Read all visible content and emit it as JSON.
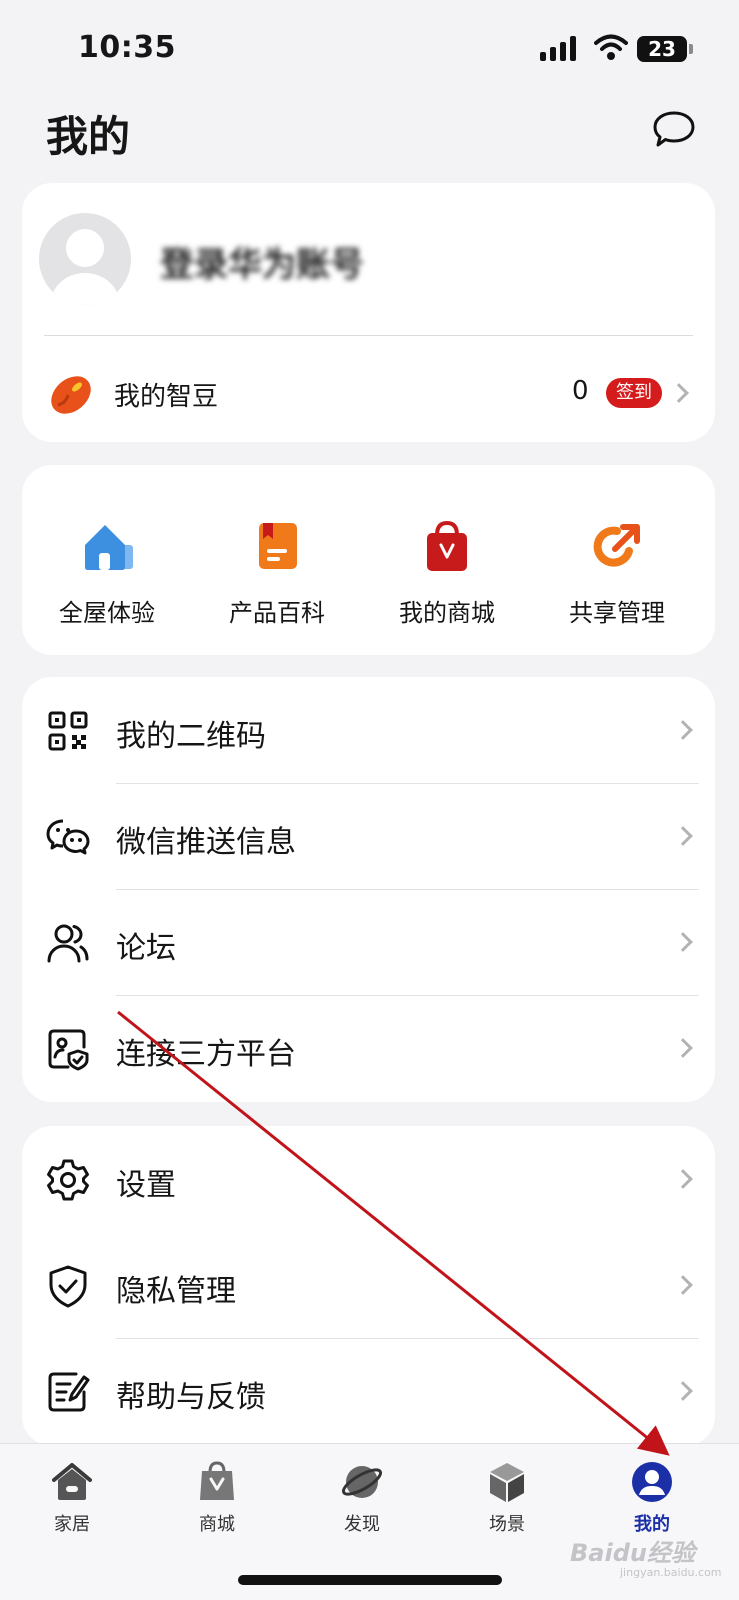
{
  "status_bar": {
    "time": "10:35",
    "battery": "23"
  },
  "page": {
    "title": "我的"
  },
  "profile": {
    "name": "登录华为账号",
    "beans_label": "我的智豆",
    "beans_count": "0",
    "checkin_label": "签到"
  },
  "services": [
    {
      "label": "全屋体验",
      "icon": "house-icon",
      "color": "#3d8fe0"
    },
    {
      "label": "产品百科",
      "icon": "book-icon",
      "color": "#f07a1a"
    },
    {
      "label": "我的商城",
      "icon": "shopping-bag-icon",
      "color": "#c71a1a"
    },
    {
      "label": "共享管理",
      "icon": "share-arrow-icon",
      "color": "#f07a1a"
    }
  ],
  "menu_group_1": [
    {
      "label": "我的二维码",
      "icon": "qr-code-icon"
    },
    {
      "label": "微信推送信息",
      "icon": "wechat-icon"
    },
    {
      "label": "论坛",
      "icon": "users-icon"
    },
    {
      "label": "连接三方平台",
      "icon": "third-party-link-icon"
    }
  ],
  "menu_group_2": [
    {
      "label": "设置",
      "icon": "gear-icon"
    },
    {
      "label": "隐私管理",
      "icon": "shield-check-icon"
    },
    {
      "label": "帮助与反馈",
      "icon": "feedback-edit-icon"
    }
  ],
  "tab_bar": [
    {
      "label": "家居",
      "icon": "home-tab-icon"
    },
    {
      "label": "商城",
      "icon": "store-tab-icon"
    },
    {
      "label": "发现",
      "icon": "discover-planet-icon"
    },
    {
      "label": "场景",
      "icon": "scene-cube-icon"
    },
    {
      "label": "我的",
      "icon": "profile-tab-icon",
      "active": true
    }
  ],
  "watermark": {
    "brand": "Baidu经验",
    "url": "jingyan.baidu.com"
  },
  "colors": {
    "accent": "#1b2fa7",
    "badge_red": "#d51c1c",
    "annotation_arrow": "#c0141a"
  }
}
